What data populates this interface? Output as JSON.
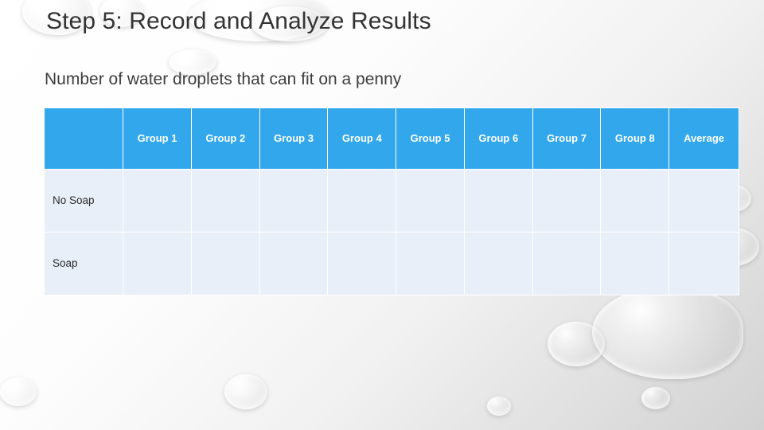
{
  "slide": {
    "title": "Step 5: Record and Analyze Results",
    "subtitle": "Number of water droplets that can fit on a penny",
    "accent_color": "#32a7ec",
    "cell_color": "#e9eff8"
  },
  "table": {
    "corner_header": "",
    "headers": [
      "Group 1",
      "Group 2",
      "Group 3",
      "Group 4",
      "Group 5",
      "Group 6",
      "Group 7",
      "Group 8",
      "Average"
    ],
    "rows": [
      {
        "label": "No Soap",
        "cells": [
          "",
          "",
          "",
          "",
          "",
          "",
          "",
          "",
          ""
        ]
      },
      {
        "label": "Soap",
        "cells": [
          "",
          "",
          "",
          "",
          "",
          "",
          "",
          "",
          ""
        ]
      }
    ]
  }
}
